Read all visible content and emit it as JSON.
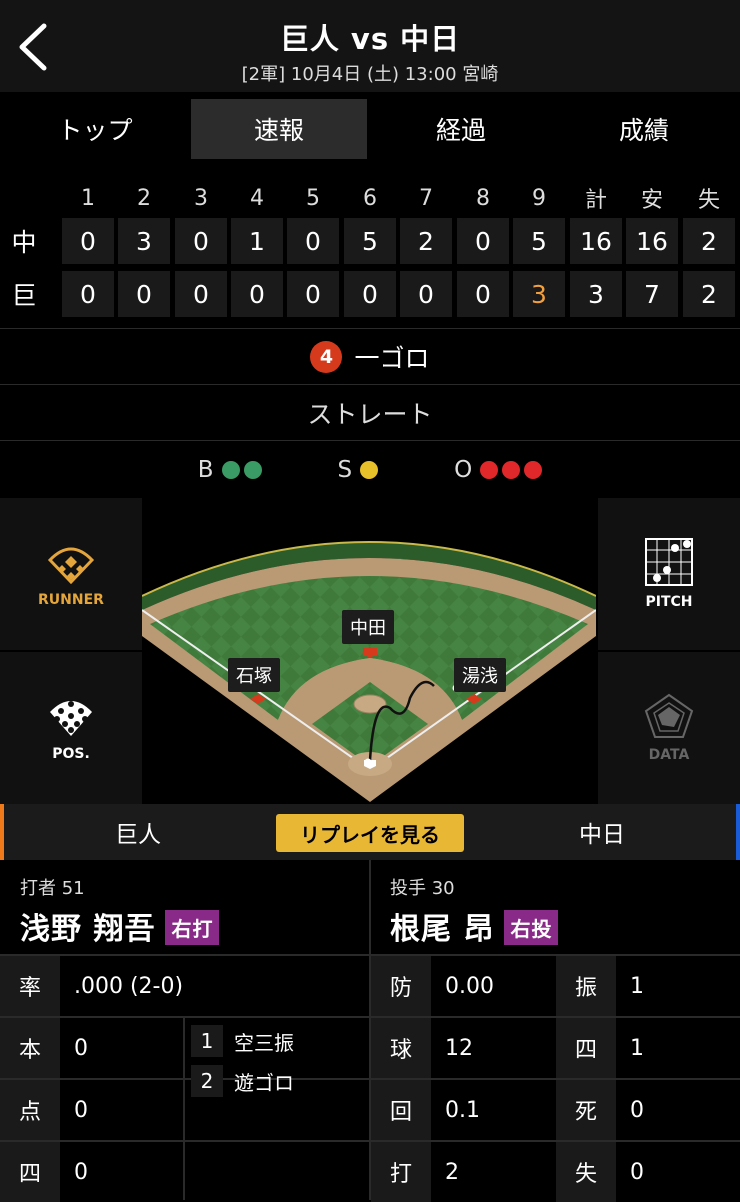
{
  "header": {
    "title": "巨人 vs 中日",
    "subtitle": "[2軍] 10月4日 (土) 13:00 宮崎"
  },
  "tabs": [
    {
      "label": "トップ",
      "active": false
    },
    {
      "label": "速報",
      "active": true
    },
    {
      "label": "経過",
      "active": false
    },
    {
      "label": "成績",
      "active": false
    }
  ],
  "scoreboard": {
    "headers": [
      "1",
      "2",
      "3",
      "4",
      "5",
      "6",
      "7",
      "8",
      "9",
      "計",
      "安",
      "失"
    ],
    "rows": [
      {
        "team": "中",
        "cells": [
          "0",
          "3",
          "0",
          "1",
          "0",
          "5",
          "2",
          "0",
          "5",
          "16",
          "16",
          "2"
        ]
      },
      {
        "team": "巨",
        "cells": [
          "0",
          "0",
          "0",
          "0",
          "0",
          "0",
          "0",
          "0",
          "3",
          "3",
          "7",
          "2"
        ]
      }
    ],
    "current_inning_color": "#f0a040"
  },
  "play": {
    "position_number": "4",
    "result": "一ゴロ",
    "pitch_type": "ストレート"
  },
  "count": {
    "b_label": "B",
    "balls": 2,
    "ball_color": "#3a9b64",
    "s_label": "S",
    "strikes": 1,
    "strike_color": "#e8c02a",
    "o_label": "O",
    "outs": 3,
    "out_color": "#e0282a"
  },
  "side_buttons": {
    "runner": "RUNNER",
    "pitch": "PITCH",
    "pos": "POS.",
    "data": "DATA"
  },
  "field": {
    "fielders": {
      "center": "中田",
      "left": "石塚",
      "right": "湯浅"
    }
  },
  "teambar": {
    "home": "巨人",
    "away": "中日",
    "replay": "リプレイを見る",
    "home_color": "#f07a1a",
    "away_color": "#1a5bd8"
  },
  "batter": {
    "role": "打者 51",
    "name": "浅野 翔吾",
    "hand": "右打",
    "stats": [
      {
        "label": "率",
        "value": ".000 (2-0)"
      },
      {
        "label": "本",
        "value": "0"
      },
      {
        "label": "点",
        "value": "0"
      },
      {
        "label": "四",
        "value": "0"
      }
    ],
    "results": [
      {
        "num": "1",
        "text": "空三振"
      },
      {
        "num": "2",
        "text": "遊ゴロ"
      }
    ]
  },
  "pitcher": {
    "role": "投手 30",
    "name": "根尾 昂",
    "hand": "右投",
    "stats_left": [
      {
        "label": "防",
        "value": "0.00"
      },
      {
        "label": "球",
        "value": "12"
      },
      {
        "label": "回",
        "value": "0.1"
      },
      {
        "label": "打",
        "value": "2"
      }
    ],
    "stats_right": [
      {
        "label": "振",
        "value": "1"
      },
      {
        "label": "四",
        "value": "1"
      },
      {
        "label": "死",
        "value": "0"
      },
      {
        "label": "失",
        "value": "0"
      }
    ]
  }
}
